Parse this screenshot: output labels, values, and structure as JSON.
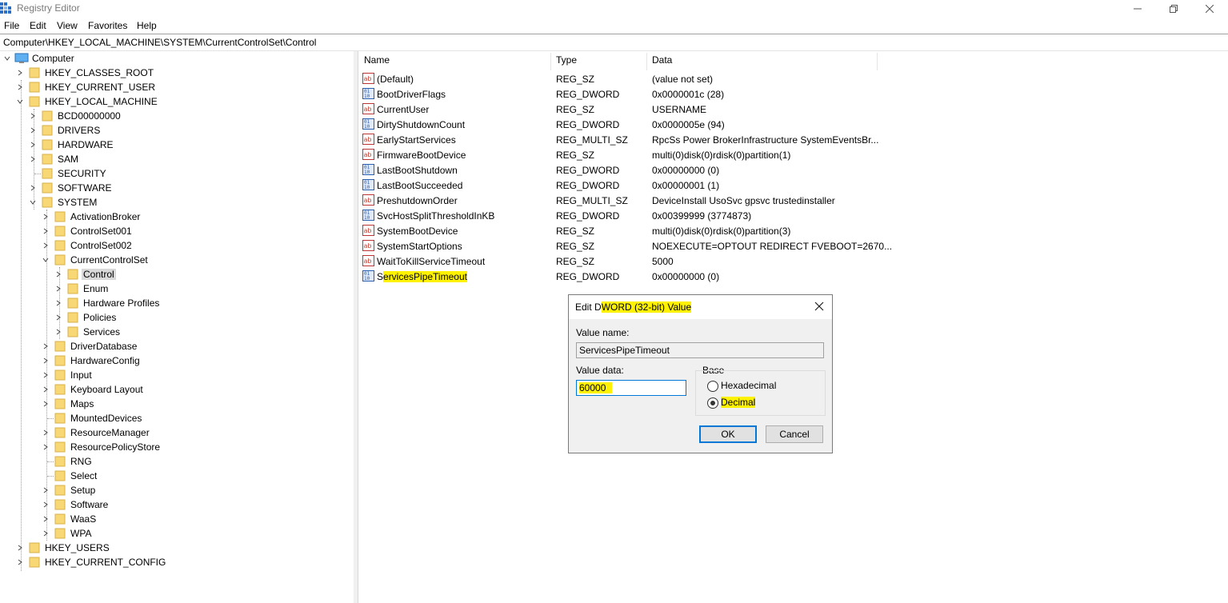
{
  "window": {
    "title": "Registry Editor"
  },
  "menu": [
    "File",
    "Edit",
    "View",
    "Favorites",
    "Help"
  ],
  "address": "Computer\\HKEY_LOCAL_MACHINE\\SYSTEM\\CurrentControlSet\\Control",
  "tree": {
    "root": "Computer",
    "hkcr": "HKEY_CLASSES_ROOT",
    "hkcu": "HKEY_CURRENT_USER",
    "hklm": "HKEY_LOCAL_MACHINE",
    "bcd": "BCD00000000",
    "drivers": "DRIVERS",
    "hardware": "HARDWARE",
    "sam": "SAM",
    "security": "SECURITY",
    "software": "SOFTWARE",
    "system": "SYSTEM",
    "activationbroker": "ActivationBroker",
    "controlset001": "ControlSet001",
    "controlset002": "ControlSet002",
    "currentcontrolset": "CurrentControlSet",
    "control": "Control",
    "enum": "Enum",
    "hwprofiles": "Hardware Profiles",
    "policies": "Policies",
    "services": "Services",
    "driverdatabase": "DriverDatabase",
    "hardwareconfig": "HardwareConfig",
    "input": "Input",
    "keyboardlayout": "Keyboard Layout",
    "maps": "Maps",
    "mounteddevices": "MountedDevices",
    "resourcemanager": "ResourceManager",
    "resourcepolicystore": "ResourcePolicyStore",
    "rng": "RNG",
    "select": "Select",
    "setup": "Setup",
    "software2": "Software",
    "waas": "WaaS",
    "wpa": "WPA",
    "hku": "HKEY_USERS",
    "hkcc": "HKEY_CURRENT_CONFIG"
  },
  "list": {
    "headers": {
      "name": "Name",
      "type": "Type",
      "data": "Data"
    },
    "rows": [
      {
        "name": "(Default)",
        "type": "REG_SZ",
        "data": "(value not set)",
        "icon": "string-icon"
      },
      {
        "name": "BootDriverFlags",
        "type": "REG_DWORD",
        "data": "0x0000001c (28)",
        "icon": "binary-icon"
      },
      {
        "name": "CurrentUser",
        "type": "REG_SZ",
        "data": "USERNAME",
        "icon": "string-icon"
      },
      {
        "name": "DirtyShutdownCount",
        "type": "REG_DWORD",
        "data": "0x0000005e (94)",
        "icon": "binary-icon"
      },
      {
        "name": "EarlyStartServices",
        "type": "REG_MULTI_SZ",
        "data": "RpcSs Power BrokerInfrastructure SystemEventsBr...",
        "icon": "string-icon"
      },
      {
        "name": "FirmwareBootDevice",
        "type": "REG_SZ",
        "data": "multi(0)disk(0)rdisk(0)partition(1)",
        "icon": "string-icon"
      },
      {
        "name": "LastBootShutdown",
        "type": "REG_DWORD",
        "data": "0x00000000 (0)",
        "icon": "binary-icon"
      },
      {
        "name": "LastBootSucceeded",
        "type": "REG_DWORD",
        "data": "0x00000001 (1)",
        "icon": "binary-icon"
      },
      {
        "name": "PreshutdownOrder",
        "type": "REG_MULTI_SZ",
        "data": "DeviceInstall UsoSvc gpsvc trustedinstaller",
        "icon": "string-icon"
      },
      {
        "name": "SvcHostSplitThresholdInKB",
        "type": "REG_DWORD",
        "data": "0x00399999 (3774873)",
        "icon": "binary-icon"
      },
      {
        "name": "SystemBootDevice",
        "type": "REG_SZ",
        "data": "multi(0)disk(0)rdisk(0)partition(3)",
        "icon": "string-icon"
      },
      {
        "name": "SystemStartOptions",
        "type": "REG_SZ",
        "data": " NOEXECUTE=OPTOUT  REDIRECT  FVEBOOT=2670...",
        "icon": "string-icon"
      },
      {
        "name": "WaitToKillServiceTimeout",
        "type": "REG_SZ",
        "data": "5000",
        "icon": "string-icon"
      }
    ],
    "selected_row": {
      "name_first": "S",
      "name_rest": "ervicesPipeTimeout",
      "type": "REG_DWORD",
      "data": "0x00000000 (0)",
      "icon": "binary-icon"
    }
  },
  "dialog": {
    "title_prefix": "Edit D",
    "title_highlight": "WORD (32-bit) Value",
    "value_name_label": "Value name:",
    "value_name": "ServicesPipeTimeout",
    "value_data_label": "Value data:",
    "value_data": "60000",
    "base_label": "Base",
    "hex_label": "Hexadecimal",
    "dec_label": "Decimal",
    "base_selected": "Decimal",
    "ok_label": "OK",
    "cancel_label": "Cancel"
  },
  "colors": {
    "highlight": "#fff200",
    "folder": "#f8d775",
    "accent": "#0078d7"
  }
}
